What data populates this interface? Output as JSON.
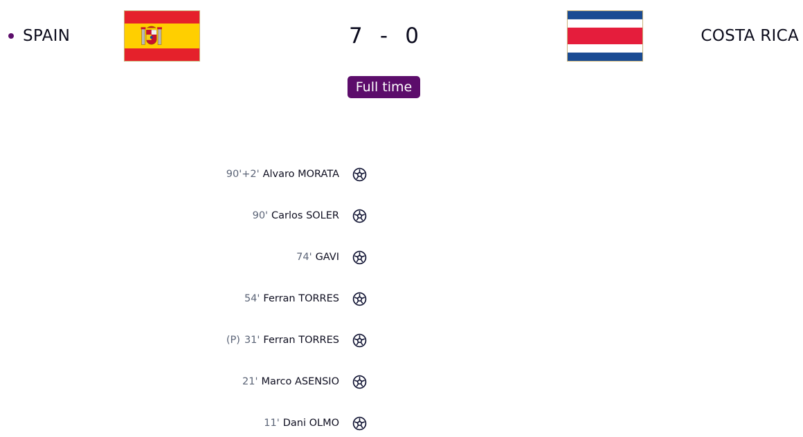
{
  "match": {
    "home_team": "SPAIN",
    "away_team": "COSTA RICA",
    "home_score": "7",
    "separator": "-",
    "away_score": "0",
    "status": "Full time"
  },
  "colors": {
    "accent": "#5c0d6b",
    "spain_red": "#e5212b",
    "spain_yellow": "#ffcf00",
    "cr_blue": "#1a4b93",
    "cr_red": "#e51d3c",
    "cr_white": "#ffffff"
  },
  "icons": {
    "home_flag": "spain-flag-icon",
    "away_flag": "costa-rica-flag-icon",
    "goal": "football-icon",
    "live": "live-dot-icon"
  },
  "goals": [
    {
      "penalty": "",
      "minute": "90'+2'",
      "player": "Alvaro MORATA"
    },
    {
      "penalty": "",
      "minute": "90'",
      "player": "Carlos SOLER"
    },
    {
      "penalty": "",
      "minute": "74'",
      "player": "GAVI"
    },
    {
      "penalty": "",
      "minute": "54'",
      "player": "Ferran TORRES"
    },
    {
      "penalty": "(P)",
      "minute": "31'",
      "player": "Ferran TORRES"
    },
    {
      "penalty": "",
      "minute": "21'",
      "player": "Marco ASENSIO"
    },
    {
      "penalty": "",
      "minute": "11'",
      "player": "Dani OLMO"
    }
  ]
}
